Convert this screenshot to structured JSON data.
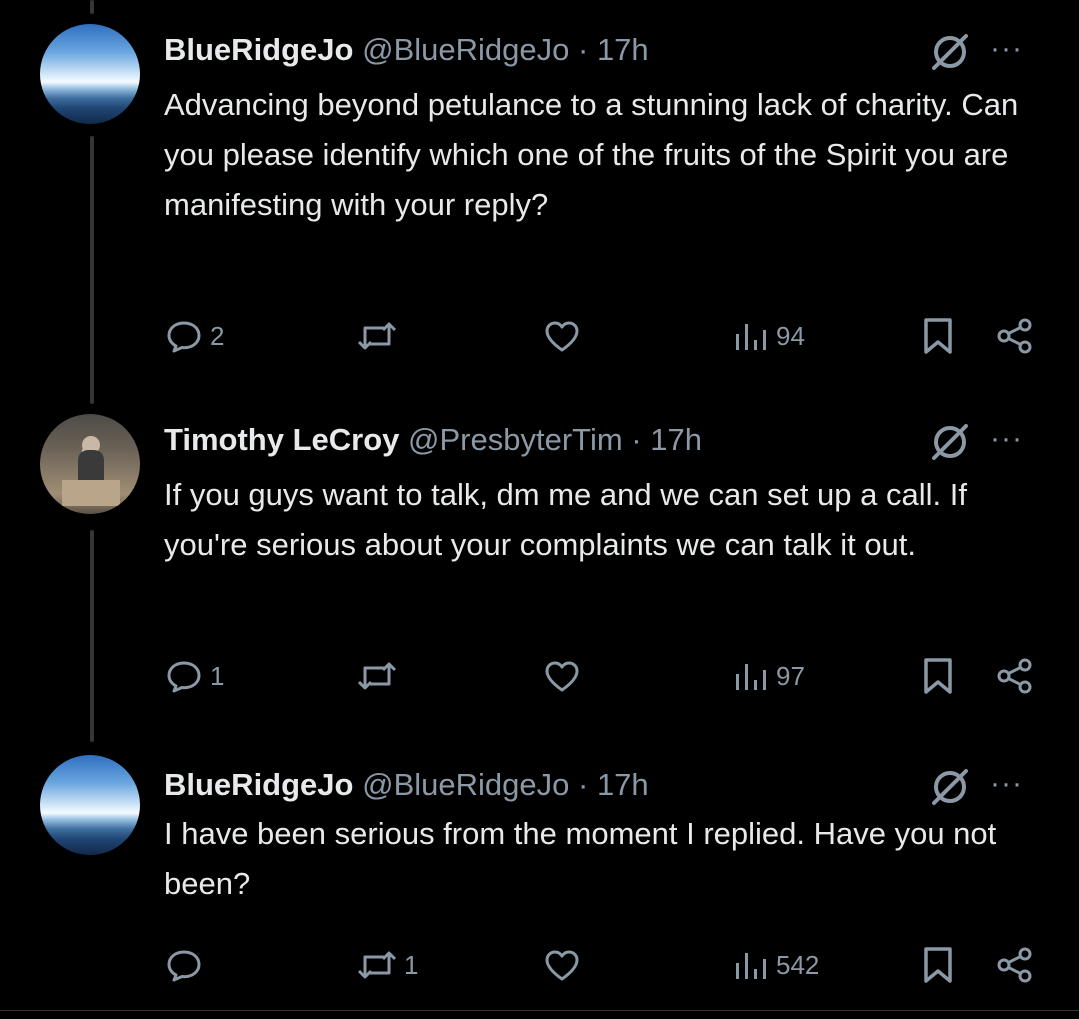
{
  "colors": {
    "background": "#000000",
    "text_primary": "#e7e9ea",
    "text_secondary": "#8b98a5",
    "thread_line": "#333639"
  },
  "tweets": [
    {
      "display_name": "BlueRidgeJo",
      "handle": "@BlueRidgeJo",
      "separator": "·",
      "time": "17h",
      "avatar_icon": "mountain-sky-avatar",
      "text": "Advancing beyond petulance to a stunning lack of charity. Can you please identify which one of the fruits of the Spirit you are manifesting with your reply?",
      "replies": "2",
      "retweets": "",
      "likes": "",
      "views": "94",
      "more_label": "···"
    },
    {
      "display_name": "Timothy LeCroy",
      "handle": "@PresbyterTim",
      "separator": "·",
      "time": "17h",
      "avatar_icon": "speaker-photo-avatar",
      "text": "If you guys want to talk, dm me and we can set up a call. If you're serious about your complaints we can talk it out.",
      "replies": "1",
      "retweets": "",
      "likes": "",
      "views": "97",
      "more_label": "···"
    },
    {
      "display_name": "BlueRidgeJo",
      "handle": "@BlueRidgeJo",
      "separator": "·",
      "time": "17h",
      "avatar_icon": "mountain-sky-avatar",
      "text": "I have been serious from the moment I replied. Have you not been?",
      "replies": "",
      "retweets": "1",
      "likes": "",
      "views": "542",
      "more_label": "···"
    }
  ]
}
